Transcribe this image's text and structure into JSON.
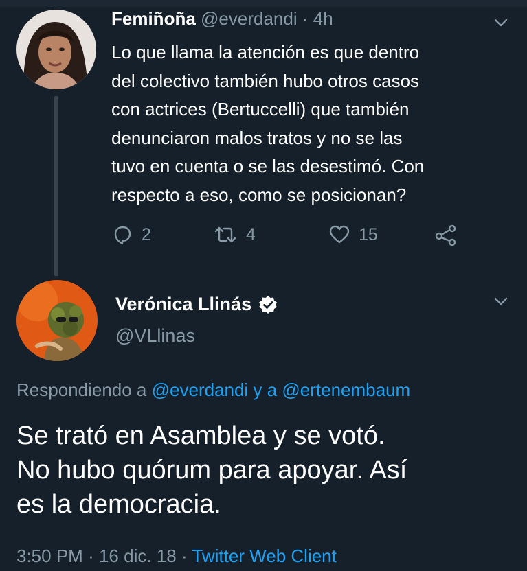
{
  "tweet1": {
    "name": "Femiñoña",
    "handle": "@everdandi",
    "separator": "·",
    "time": "4h",
    "lines": [
      "Lo que llama la atención es que dentro",
      "del colectivo también hubo otros casos",
      "con actrices (Bertuccelli) que también",
      "denunciaron malos tratos y no se las",
      "tuvo en cuenta o se las desestimó. Con",
      "respecto a eso, como se posicionan?"
    ],
    "actions": {
      "replies": "2",
      "retweets": "4",
      "likes": "15",
      "reply_icon": "reply-icon",
      "retweet_icon": "retweet-icon",
      "like_icon": "heart-icon",
      "share_icon": "share-icon"
    }
  },
  "tweet2": {
    "name": "Verónica Llinás",
    "handle": "@VLlinas",
    "verified_icon": "verified-badge-icon",
    "reply_prefix": "Respondiendo a",
    "reply_user1": "@everdandi",
    "reply_and": "y a",
    "reply_user2": "@ertenembaum",
    "lines": [
      "Se trató en Asamblea y se votó.",
      "No hubo quórum para apoyar. Así",
      "es la democracia."
    ],
    "time": "3:50 PM",
    "sep1": "·",
    "date": "16 dic. 18",
    "sep2": "·",
    "client": "Twitter Web Client"
  },
  "colors": {
    "background": "#15202b",
    "secondary_text": "#8899a6",
    "link": "#1da1f2",
    "thread_line": "#38444d"
  }
}
